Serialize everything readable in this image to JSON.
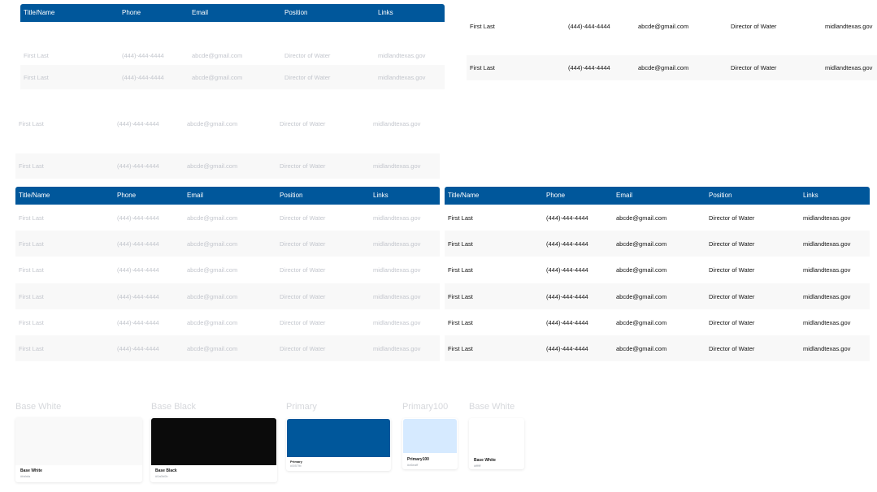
{
  "headers": [
    "Title/Name",
    "Phone",
    "Email",
    "Position",
    "Links"
  ],
  "row_values": [
    "First Last",
    "(444)-444-4444",
    "abcde@gmail.com",
    "Director of Water",
    "midlandtexas.gov"
  ],
  "colors": {
    "primary": "#00579b",
    "base_white": "#f9f9f9",
    "base_black": "#0b0b0b",
    "primary100": "#d6eaff",
    "pure_white": "#ffffff",
    "faded_text": "#c3c6cd"
  },
  "swatches": [
    {
      "title": "Base White",
      "name": "Base White",
      "hex": "#fafafa"
    },
    {
      "title": "Base Black",
      "name": "Base Black",
      "hex": "#0a0b0b"
    },
    {
      "title": "Primary",
      "name": "Primary",
      "hex": "#00579b"
    },
    {
      "title": "Primary100",
      "name": "Primary100",
      "hex": "#d6eaff"
    },
    {
      "title": "Base White",
      "name": "Base White",
      "hex": "#ffffff"
    }
  ]
}
